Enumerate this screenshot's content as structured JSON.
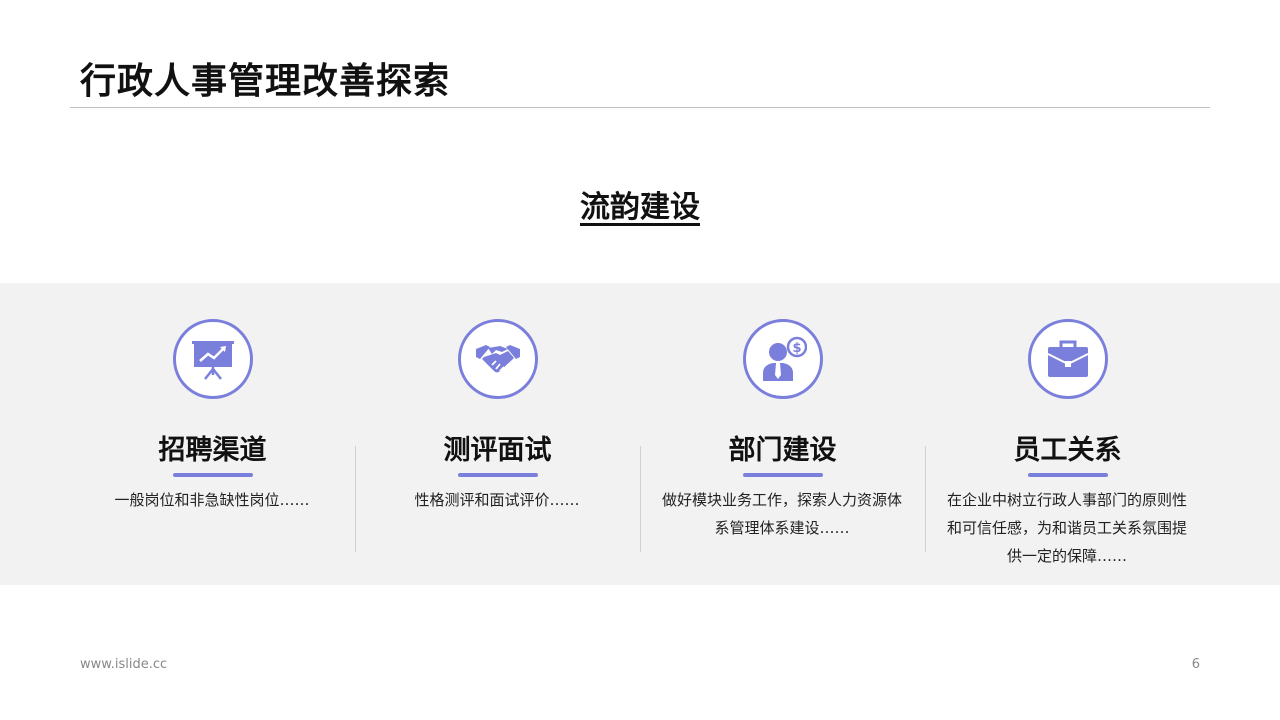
{
  "header": {
    "title": "行政人事管理改善探索"
  },
  "section": {
    "subtitle": "流韵建设"
  },
  "items": [
    {
      "icon": "presentation-chart-icon",
      "title": "招聘渠道",
      "desc": "一般岗位和非急缺性岗位……"
    },
    {
      "icon": "handshake-icon",
      "title": "测评面试",
      "desc": "性格测评和面试评价……"
    },
    {
      "icon": "person-dollar-icon",
      "title": "部门建设",
      "desc": "做好模块业务工作，探索人力资源体系管理体系建设……"
    },
    {
      "icon": "briefcase-icon",
      "title": "员工关系",
      "desc": "在企业中树立行政人事部门的原则性和可信任感，为和谐员工关系氛围提供一定的保障……"
    }
  ],
  "footer": {
    "website": "www.islide.cc",
    "page_number": "6"
  },
  "colors": {
    "accent": "#7b7fdc",
    "band": "#f2f2f2"
  }
}
